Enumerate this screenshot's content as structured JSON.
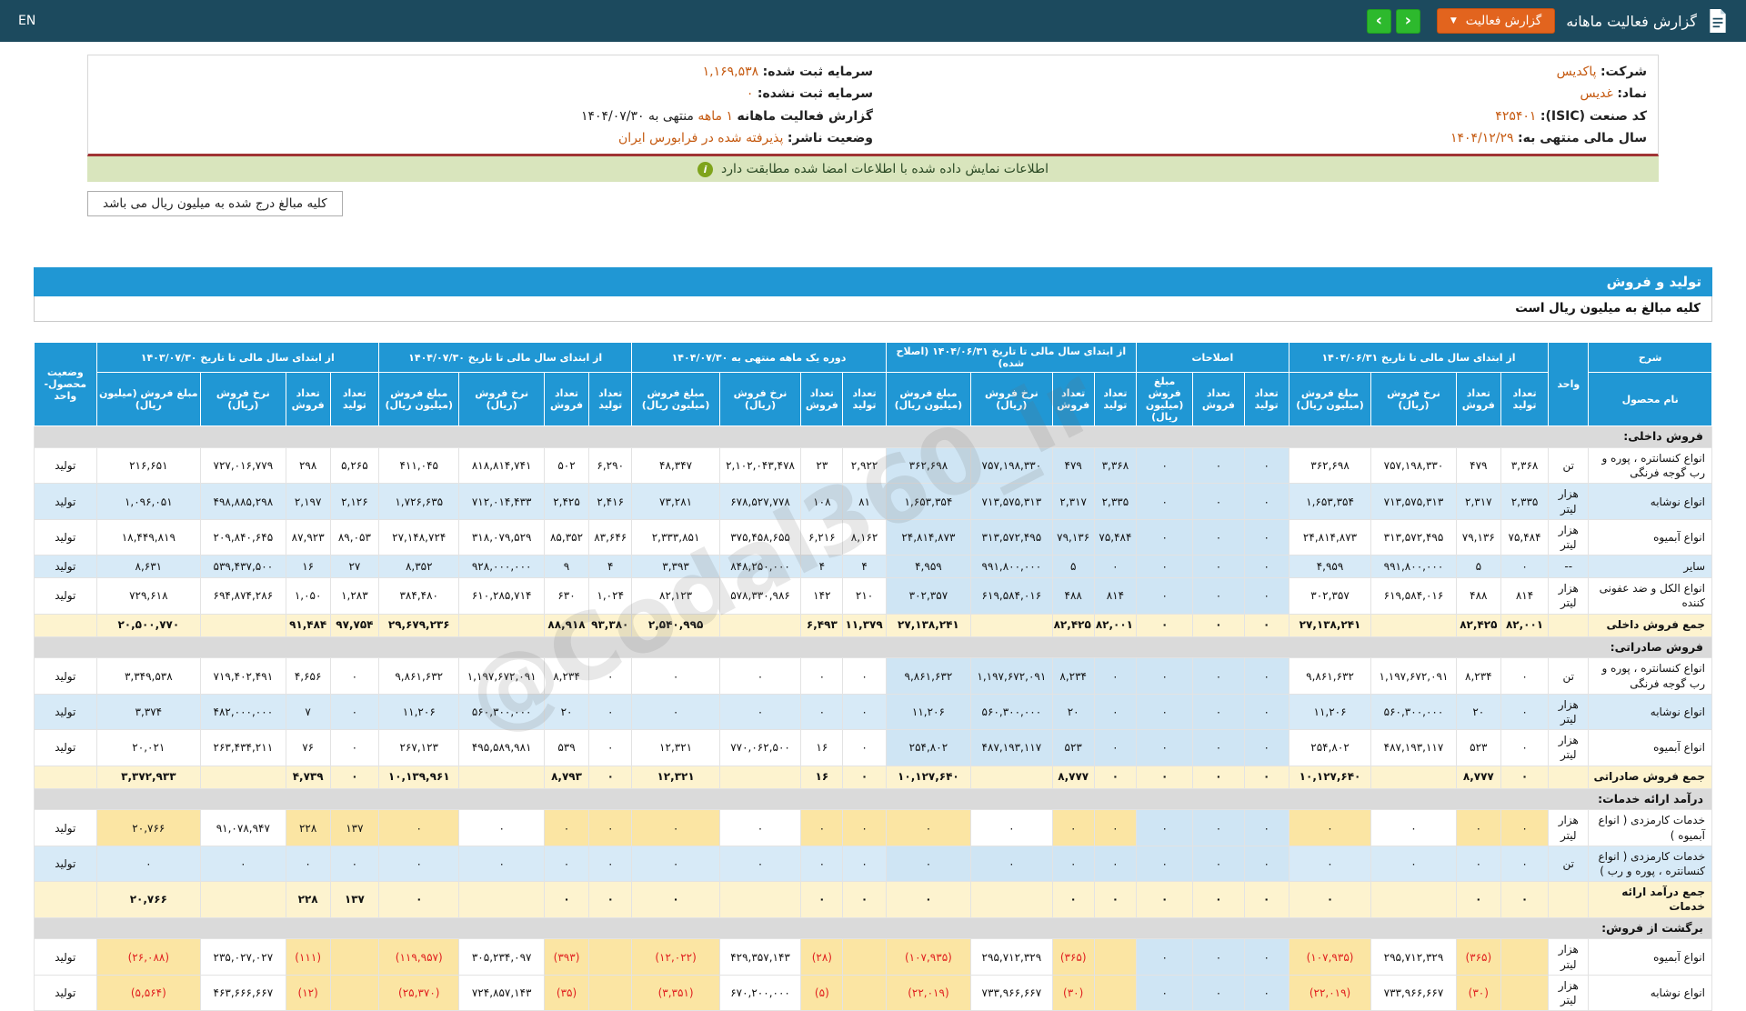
{
  "topbar": {
    "title": "گزارش فعالیت ماهانه",
    "report_button": "گزارش فعالیت",
    "nav_prev": "‹",
    "nav_next": "›",
    "lang": "EN"
  },
  "info": {
    "right": [
      {
        "label": "شرکت:",
        "value": "پاکدیس"
      },
      {
        "label": "نماد:",
        "value": "غدیس"
      },
      {
        "label": "کد صنعت (ISIC):",
        "value": "۴۲۵۴۰۱"
      },
      {
        "label": "سال مالی منتهی به:",
        "value": "۱۴۰۴/۱۲/۲۹"
      }
    ],
    "left": [
      {
        "label": "سرمایه ثبت شده:",
        "value": "۱,۱۶۹,۵۳۸"
      },
      {
        "label": "سرمایه ثبت نشده:",
        "value": "۰"
      },
      {
        "label": "گزارش فعالیت ماهانه",
        "value": "۱ ماهه",
        "suffix": "منتهی به ۱۴۰۴/۰۷/۳۰"
      },
      {
        "label": "وضعیت ناشر:",
        "value": "پذیرفته شده در فرابورس ایران"
      }
    ],
    "signed_notice": "اطلاعات نمایش داده شده با اطلاعات امضا شده مطابقت دارد",
    "amount_note": "کلیه مبالغ درج شده به میلیون ریال می باشد"
  },
  "section": {
    "title": "تولید و فروش",
    "subtitle": "کلیه مبالغ به میلیون ریال است"
  },
  "watermark": "@Codal360_ir",
  "colors": {
    "topbar_bg": "#1c4a5e",
    "accent_orange": "#e2641e",
    "nav_green": "#2db92d",
    "link_orange": "#c55a11",
    "header_blue": "#2097d4",
    "stripe_blue": "#d7eaf7",
    "computed_blue": "#cfe5f4",
    "sum_yellow": "#fdf3cf",
    "entry_yellow": "#fbe5a3",
    "section_gray": "#dadada",
    "notice_green_bg": "#d9e5bd",
    "negative_red": "#e01f1f",
    "divider_maroon": "#a03434"
  },
  "table": {
    "col_desc": "شرح",
    "col_name": "نام محصول",
    "col_unit": "واحد",
    "col_status": "وضعیت محصول-واحد",
    "sub": {
      "prod": "تعداد تولید",
      "sold": "تعداد فروش",
      "rate": "نرخ فروش (ریال)",
      "amount": "مبلغ فروش (میلیون ریال)"
    },
    "groups": [
      {
        "label": "از ابتدای سال مالی تا تاریخ ۱۴۰۴/۰۶/۳۱",
        "cols": 4
      },
      {
        "label": "اصلاحات",
        "cols": 3
      },
      {
        "label": "از ابتدای سال مالی تا تاریخ ۱۴۰۴/۰۶/۳۱ (اصلاح شده)",
        "cols": 4
      },
      {
        "label": "دوره یک ماهه منتهی به ۱۴۰۴/۰۷/۳۰",
        "cols": 4
      },
      {
        "label": "از ابتدای سال مالی تا تاریخ ۱۴۰۴/۰۷/۳۰",
        "cols": 4
      },
      {
        "label": "از ابتدای سال مالی تا تاریخ ۱۴۰۳/۰۷/۳۰",
        "cols": 4
      }
    ],
    "rows": [
      {
        "type": "section",
        "name": "فروش داخلی:"
      },
      {
        "type": "data",
        "alt": false,
        "name": "انواع کنسانتره ، پوره و رب گوجه فرنگی",
        "unit": "تن",
        "status": "تولید",
        "cells": [
          "۳,۳۶۸",
          "۴۷۹",
          "۷۵۷,۱۹۸,۳۳۰",
          "۳۶۲,۶۹۸",
          "۰",
          "۰",
          "۰",
          "۳,۳۶۸",
          "۴۷۹",
          "۷۵۷,۱۹۸,۳۳۰",
          "۳۶۲,۶۹۸",
          "۲,۹۲۲",
          "۲۳",
          "۲,۱۰۲,۰۴۳,۴۷۸",
          "۴۸,۳۴۷",
          "۶,۲۹۰",
          "۵۰۲",
          "۸۱۸,۸۱۴,۷۴۱",
          "۴۱۱,۰۴۵",
          "۵,۲۶۵",
          "۲۹۸",
          "۷۲۷,۰۱۶,۷۷۹",
          "۲۱۶,۶۵۱"
        ]
      },
      {
        "type": "data",
        "alt": true,
        "name": "انواع نوشابه",
        "unit": "هزار لیتر",
        "status": "تولید",
        "cells": [
          "۲,۳۳۵",
          "۲,۳۱۷",
          "۷۱۳,۵۷۵,۳۱۳",
          "۱,۶۵۳,۳۵۴",
          "۰",
          "۰",
          "۰",
          "۲,۳۳۵",
          "۲,۳۱۷",
          "۷۱۳,۵۷۵,۳۱۳",
          "۱,۶۵۳,۳۵۴",
          "۸۱",
          "۱۰۸",
          "۶۷۸,۵۲۷,۷۷۸",
          "۷۳,۲۸۱",
          "۲,۴۱۶",
          "۲,۴۲۵",
          "۷۱۲,۰۱۴,۴۳۳",
          "۱,۷۲۶,۶۳۵",
          "۲,۱۲۶",
          "۲,۱۹۷",
          "۴۹۸,۸۸۵,۲۹۸",
          "۱,۰۹۶,۰۵۱"
        ]
      },
      {
        "type": "data",
        "alt": false,
        "name": "انواع آبمیوه",
        "unit": "هزار لیتر",
        "status": "تولید",
        "cells": [
          "۷۵,۴۸۴",
          "۷۹,۱۳۶",
          "۳۱۳,۵۷۲,۴۹۵",
          "۲۴,۸۱۴,۸۷۳",
          "۰",
          "۰",
          "۰",
          "۷۵,۴۸۴",
          "۷۹,۱۳۶",
          "۳۱۳,۵۷۲,۴۹۵",
          "۲۴,۸۱۴,۸۷۳",
          "۸,۱۶۲",
          "۶,۲۱۶",
          "۳۷۵,۴۵۸,۶۵۵",
          "۲,۳۳۳,۸۵۱",
          "۸۳,۶۴۶",
          "۸۵,۳۵۲",
          "۳۱۸,۰۷۹,۵۲۹",
          "۲۷,۱۴۸,۷۲۴",
          "۸۹,۰۵۳",
          "۸۷,۹۲۳",
          "۲۰۹,۸۴۰,۶۴۵",
          "۱۸,۴۴۹,۸۱۹"
        ]
      },
      {
        "type": "data",
        "alt": true,
        "name": "سایر",
        "unit": "--",
        "status": "تولید",
        "cells": [
          "۰",
          "۵",
          "۹۹۱,۸۰۰,۰۰۰",
          "۴,۹۵۹",
          "۰",
          "۰",
          "۰",
          "۰",
          "۵",
          "۹۹۱,۸۰۰,۰۰۰",
          "۴,۹۵۹",
          "۴",
          "۴",
          "۸۴۸,۲۵۰,۰۰۰",
          "۳,۳۹۳",
          "۴",
          "۹",
          "۹۲۸,۰۰۰,۰۰۰",
          "۸,۳۵۲",
          "۲۷",
          "۱۶",
          "۵۳۹,۴۳۷,۵۰۰",
          "۸,۶۳۱"
        ]
      },
      {
        "type": "data",
        "alt": false,
        "name": "انواع الکل و ضد عفونی کننده",
        "unit": "هزار لیتر",
        "status": "تولید",
        "cells": [
          "۸۱۴",
          "۴۸۸",
          "۶۱۹,۵۸۴,۰۱۶",
          "۳۰۲,۳۵۷",
          "۰",
          "۰",
          "۰",
          "۸۱۴",
          "۴۸۸",
          "۶۱۹,۵۸۴,۰۱۶",
          "۳۰۲,۳۵۷",
          "۲۱۰",
          "۱۴۲",
          "۵۷۸,۳۳۰,۹۸۶",
          "۸۲,۱۲۳",
          "۱,۰۲۴",
          "۶۳۰",
          "۶۱۰,۲۸۵,۷۱۴",
          "۳۸۴,۴۸۰",
          "۱,۲۸۳",
          "۱,۰۵۰",
          "۶۹۴,۸۷۴,۲۸۶",
          "۷۲۹,۶۱۸"
        ]
      },
      {
        "type": "sum",
        "name": "جمع فروش داخلی",
        "unit": "",
        "status": "",
        "cells": [
          "۸۲,۰۰۱",
          "۸۲,۴۲۵",
          "",
          "۲۷,۱۳۸,۲۴۱",
          "۰",
          "۰",
          "۰",
          "۸۲,۰۰۱",
          "۸۲,۴۲۵",
          "",
          "۲۷,۱۳۸,۲۴۱",
          "۱۱,۳۷۹",
          "۶,۴۹۳",
          "",
          "۲,۵۴۰,۹۹۵",
          "۹۳,۳۸۰",
          "۸۸,۹۱۸",
          "",
          "۲۹,۶۷۹,۲۳۶",
          "۹۷,۷۵۴",
          "۹۱,۴۸۴",
          "",
          "۲۰,۵۰۰,۷۷۰"
        ]
      },
      {
        "type": "section",
        "name": "فروش صادراتی:"
      },
      {
        "type": "data",
        "alt": false,
        "name": "انواع کنسانتره ، پوره و رب گوجه فرنگی",
        "unit": "تن",
        "status": "تولید",
        "cells": [
          "۰",
          "۸,۲۳۴",
          "۱,۱۹۷,۶۷۲,۰۹۱",
          "۹,۸۶۱,۶۳۲",
          "۰",
          "۰",
          "۰",
          "۰",
          "۸,۲۳۴",
          "۱,۱۹۷,۶۷۲,۰۹۱",
          "۹,۸۶۱,۶۳۲",
          "۰",
          "۰",
          "۰",
          "۰",
          "۰",
          "۸,۲۳۴",
          "۱,۱۹۷,۶۷۲,۰۹۱",
          "۹,۸۶۱,۶۳۲",
          "۰",
          "۴,۶۵۶",
          "۷۱۹,۴۰۲,۴۹۱",
          "۳,۳۴۹,۵۳۸"
        ]
      },
      {
        "type": "data",
        "alt": true,
        "name": "انواع نوشابه",
        "unit": "هزار لیتر",
        "status": "تولید",
        "cells": [
          "۰",
          "۲۰",
          "۵۶۰,۳۰۰,۰۰۰",
          "۱۱,۲۰۶",
          "۰",
          "۰",
          "۰",
          "۰",
          "۲۰",
          "۵۶۰,۳۰۰,۰۰۰",
          "۱۱,۲۰۶",
          "۰",
          "۰",
          "۰",
          "۰",
          "۰",
          "۲۰",
          "۵۶۰,۳۰۰,۰۰۰",
          "۱۱,۲۰۶",
          "۰",
          "۷",
          "۴۸۲,۰۰۰,۰۰۰",
          "۳,۳۷۴"
        ]
      },
      {
        "type": "data",
        "alt": false,
        "name": "انواع آبمیوه",
        "unit": "هزار لیتر",
        "status": "تولید",
        "cells": [
          "۰",
          "۵۲۳",
          "۴۸۷,۱۹۳,۱۱۷",
          "۲۵۴,۸۰۲",
          "۰",
          "۰",
          "۰",
          "۰",
          "۵۲۳",
          "۴۸۷,۱۹۳,۱۱۷",
          "۲۵۴,۸۰۲",
          "۰",
          "۱۶",
          "۷۷۰,۰۶۲,۵۰۰",
          "۱۲,۳۲۱",
          "۰",
          "۵۳۹",
          "۴۹۵,۵۸۹,۹۸۱",
          "۲۶۷,۱۲۳",
          "۰",
          "۷۶",
          "۲۶۳,۴۳۴,۲۱۱",
          "۲۰,۰۲۱"
        ]
      },
      {
        "type": "sum",
        "name": "جمع فروش صادراتی",
        "unit": "",
        "status": "",
        "cells": [
          "۰",
          "۸,۷۷۷",
          "",
          "۱۰,۱۲۷,۶۴۰",
          "۰",
          "۰",
          "۰",
          "۰",
          "۸,۷۷۷",
          "",
          "۱۰,۱۲۷,۶۴۰",
          "۰",
          "۱۶",
          "",
          "۱۲,۳۲۱",
          "۰",
          "۸,۷۹۳",
          "",
          "۱۰,۱۳۹,۹۶۱",
          "۰",
          "۴,۷۳۹",
          "",
          "۳,۳۷۲,۹۳۳"
        ]
      },
      {
        "type": "section",
        "name": "درآمد ارائه خدمات:"
      },
      {
        "type": "data",
        "entry": true,
        "name": "خدمات کارمزدی ( انواع آبمیوه )",
        "unit": "هزار لیتر",
        "status": "تولید",
        "cells": [
          "۰",
          "۰",
          "۰",
          "۰",
          "۰",
          "۰",
          "۰",
          "۰",
          "۰",
          "۰",
          "۰",
          "۰",
          "۰",
          "۰",
          "۰",
          "۰",
          "۰",
          "۰",
          "۰",
          "۱۳۷",
          "۲۲۸",
          "۹۱,۰۷۸,۹۴۷",
          "۲۰,۷۶۶"
        ]
      },
      {
        "type": "data",
        "alt": true,
        "name": "خدمات کارمزدی ( انواع کنسانتره ، پوره و رب )",
        "unit": "تن",
        "status": "تولید",
        "cells": [
          "۰",
          "۰",
          "۰",
          "۰",
          "۰",
          "۰",
          "۰",
          "۰",
          "۰",
          "۰",
          "۰",
          "۰",
          "۰",
          "۰",
          "۰",
          "۰",
          "۰",
          "۰",
          "۰",
          "۰",
          "۰",
          "۰",
          "۰"
        ]
      },
      {
        "type": "sum",
        "name": "جمع درآمد ارائه خدمات",
        "unit": "",
        "status": "",
        "cells": [
          "۰",
          "۰",
          "",
          "۰",
          "۰",
          "۰",
          "۰",
          "۰",
          "۰",
          "",
          "۰",
          "۰",
          "۰",
          "",
          "۰",
          "۰",
          "۰",
          "",
          "۰",
          "۱۳۷",
          "۲۲۸",
          "",
          "۲۰,۷۶۶"
        ]
      },
      {
        "type": "section",
        "name": "برگشت از فروش:"
      },
      {
        "type": "data",
        "entry": true,
        "name": "انواع آبمیوه",
        "unit": "هزار لیتر",
        "status": "تولید",
        "cells": [
          "",
          "(۳۶۵)",
          "۲۹۵,۷۱۲,۳۲۹",
          "(۱۰۷,۹۳۵)",
          "۰",
          "۰",
          "۰",
          "",
          "(۳۶۵)",
          "۲۹۵,۷۱۲,۳۲۹",
          "(۱۰۷,۹۳۵)",
          "",
          "(۲۸)",
          "۴۲۹,۳۵۷,۱۴۳",
          "(۱۲,۰۲۲)",
          "",
          "(۳۹۳)",
          "۳۰۵,۲۳۴,۰۹۷",
          "(۱۱۹,۹۵۷)",
          "",
          "(۱۱۱)",
          "۲۳۵,۰۲۷,۰۲۷",
          "(۲۶,۰۸۸)"
        ]
      },
      {
        "type": "data",
        "entry": true,
        "name": "انواع نوشابه",
        "unit": "هزار لیتر",
        "status": "تولید",
        "cells": [
          "",
          "(۳۰)",
          "۷۳۳,۹۶۶,۶۶۷",
          "(۲۲,۰۱۹)",
          "۰",
          "۰",
          "۰",
          "",
          "(۳۰)",
          "۷۳۳,۹۶۶,۶۶۷",
          "(۲۲,۰۱۹)",
          "",
          "(۵)",
          "۶۷۰,۲۰۰,۰۰۰",
          "(۳,۳۵۱)",
          "",
          "(۳۵)",
          "۷۲۴,۸۵۷,۱۴۳",
          "(۲۵,۳۷۰)",
          "",
          "(۱۲)",
          "۴۶۳,۶۶۶,۶۶۷",
          "(۵,۵۶۴)"
        ]
      }
    ]
  }
}
